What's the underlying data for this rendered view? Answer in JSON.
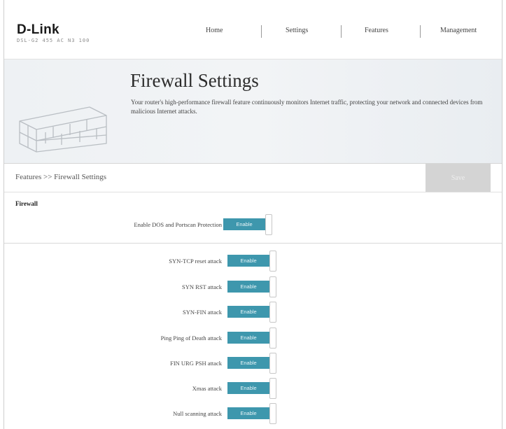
{
  "header": {
    "logo": "D-Link",
    "model": "DSL-G2 455 AC N3 100",
    "nav": [
      "Home",
      "Settings",
      "Features",
      "Management"
    ]
  },
  "hero": {
    "title": "Firewall Settings",
    "description": "Your router's high-performance firewall feature continuously monitors Internet traffic, protecting your network and connected devices from malicious Internet attacks."
  },
  "breadcrumb": "Features >> Firewall Settings",
  "save_label": "Save",
  "section": {
    "title": "Firewall",
    "main_toggle": {
      "label": "Enable DOS and Portscan Protection",
      "state": "Enable"
    }
  },
  "attacks": [
    {
      "label": "SYN-TCP reset attack",
      "state": "Enable"
    },
    {
      "label": "SYN RST attack",
      "state": "Enable"
    },
    {
      "label": "SYN-FIN attack",
      "state": "Enable"
    },
    {
      "label": "Ping Ping of Death attack",
      "state": "Enable"
    },
    {
      "label": "FIN URG PSH attack",
      "state": "Enable"
    },
    {
      "label": "Xmas attack",
      "state": "Enable"
    },
    {
      "label": "Null scanning attack",
      "state": "Enable"
    }
  ],
  "colors": {
    "toggle_on": "#3e97ad",
    "save_disabled": "#d4d4d4"
  }
}
